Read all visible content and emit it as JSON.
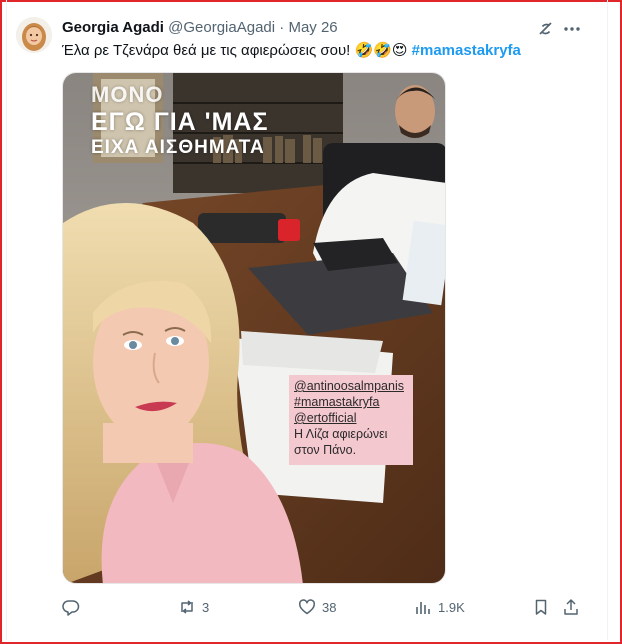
{
  "tweet": {
    "author_name": "Georgia Agadi",
    "handle": "@GeorgiaAgadi",
    "separator": "·",
    "date": "May 26",
    "text": "Έλα ρε Τζενάρα θεά με τις αφιερώσεις σου! 🤣🤣😍",
    "hashtag": "#mamastakryfa"
  },
  "media": {
    "story_title_line1": "ΜΟΝΟ",
    "story_title_line2": "ΕΓΩ ΓΙΑ 'ΜΑΣ",
    "story_title_line3": "ΕΙΧΑ ΑΙΣΘΗΜΑΤΑ",
    "sticker": {
      "tags": [
        "@antinoosalmpanis",
        "#mamastakryfa",
        "@ertofficial"
      ],
      "caption_line1": "Η Λίζα αφιερώνει",
      "caption_line2": "στον Πάνο."
    }
  },
  "actions": {
    "replies": "",
    "retweets": "3",
    "likes": "38",
    "views": "1.9K"
  },
  "icons": {
    "grok": "grok-icon",
    "more": "more-icon",
    "reply": "reply-icon",
    "retweet": "retweet-icon",
    "like": "heart-icon",
    "views": "views-icon",
    "bookmark": "bookmark-icon",
    "share": "share-icon"
  },
  "colors": {
    "hashtag": "#1d9bf0",
    "secondary_text": "#536471",
    "frame_border": "#e0262b",
    "sticker_bg": "#f4c8cf"
  }
}
